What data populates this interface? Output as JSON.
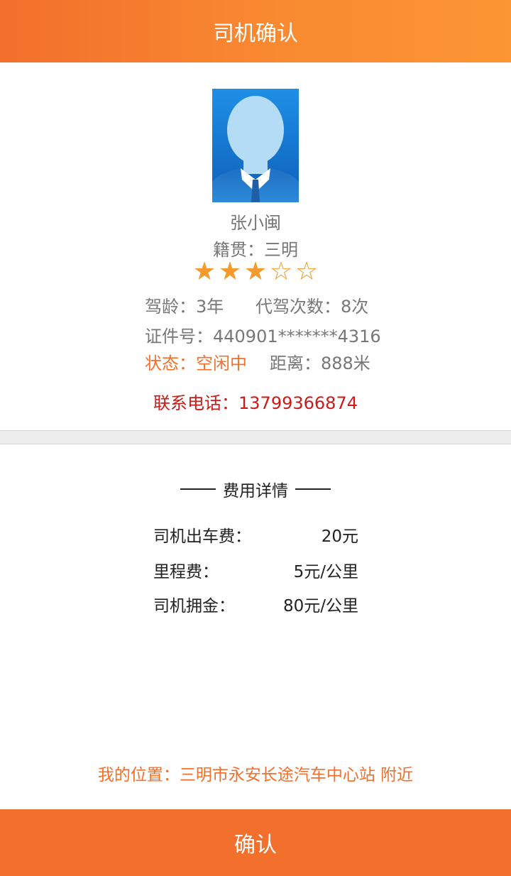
{
  "header": {
    "title": "司机确认"
  },
  "driver": {
    "name": "张小闽",
    "hometown": "籍贯：三明",
    "rating": {
      "value": 3,
      "max": 5,
      "filled_star": "★",
      "empty_star": "☆"
    },
    "driving_years": "驾龄：3年",
    "trips": "代驾次数：8次",
    "id_number": "证件号：440901*******4316",
    "status": "状态：空闲中",
    "distance": "距离：888米",
    "phone": "联系电话：13799366874",
    "avatar_icon": "person-silhouette-icon"
  },
  "fees": {
    "title": "费用详情",
    "items": [
      {
        "label": "司机出车费：",
        "value": "20元"
      },
      {
        "label": "里程费：",
        "value": "5元/公里"
      },
      {
        "label": "司机拥金：",
        "value": "80元/公里"
      }
    ]
  },
  "location": "我的位置：三明市永安长途汽车中心站 附近",
  "confirm_button": {
    "label": "确认"
  },
  "colors": {
    "accent": "#f26f2c",
    "star": "#f59a2c",
    "phone": "#cc1a1a"
  }
}
